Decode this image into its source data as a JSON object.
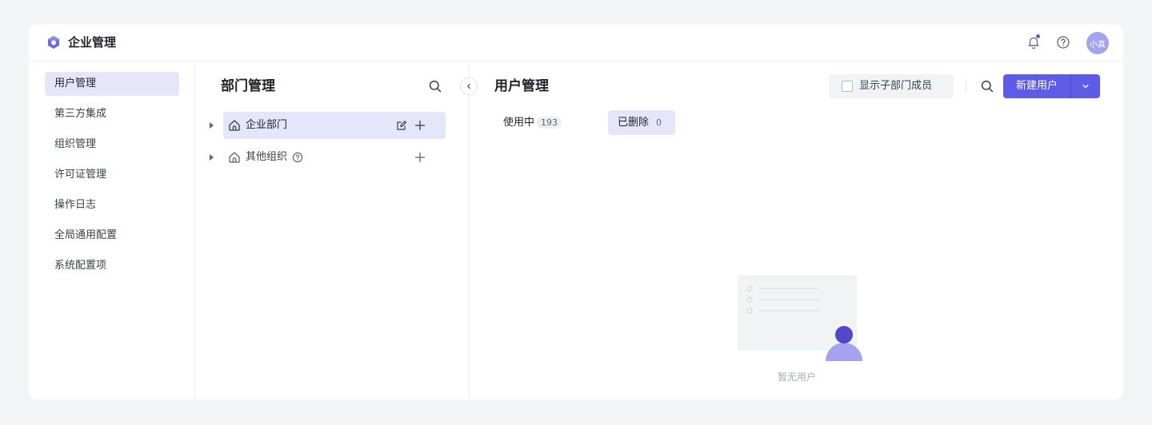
{
  "app": {
    "title": "企业管理",
    "avatar_text": "小真",
    "colors": {
      "accent": "#5e5ce6",
      "active_bg": "#e6e6fb",
      "notification_dot": "#5b5bd6"
    }
  },
  "sidebar": {
    "items": [
      {
        "label": "用户管理",
        "active": true
      },
      {
        "label": "第三方集成"
      },
      {
        "label": "组织管理"
      },
      {
        "label": "许可证管理"
      },
      {
        "label": "操作日志"
      },
      {
        "label": "全局通用配置"
      },
      {
        "label": "系统配置项"
      }
    ]
  },
  "dept_panel": {
    "title": "部门管理",
    "tree": [
      {
        "label": "企业部门",
        "active": true
      },
      {
        "label": "其他组织"
      }
    ]
  },
  "main": {
    "title": "用户管理",
    "show_sub_members_label": "显示子部门成员",
    "new_user_label": "新建用户",
    "tabs": [
      {
        "label": "使用中",
        "count": "193"
      },
      {
        "label": "已删除",
        "count": "0",
        "active": true
      }
    ],
    "empty_text": "暂无用户"
  }
}
